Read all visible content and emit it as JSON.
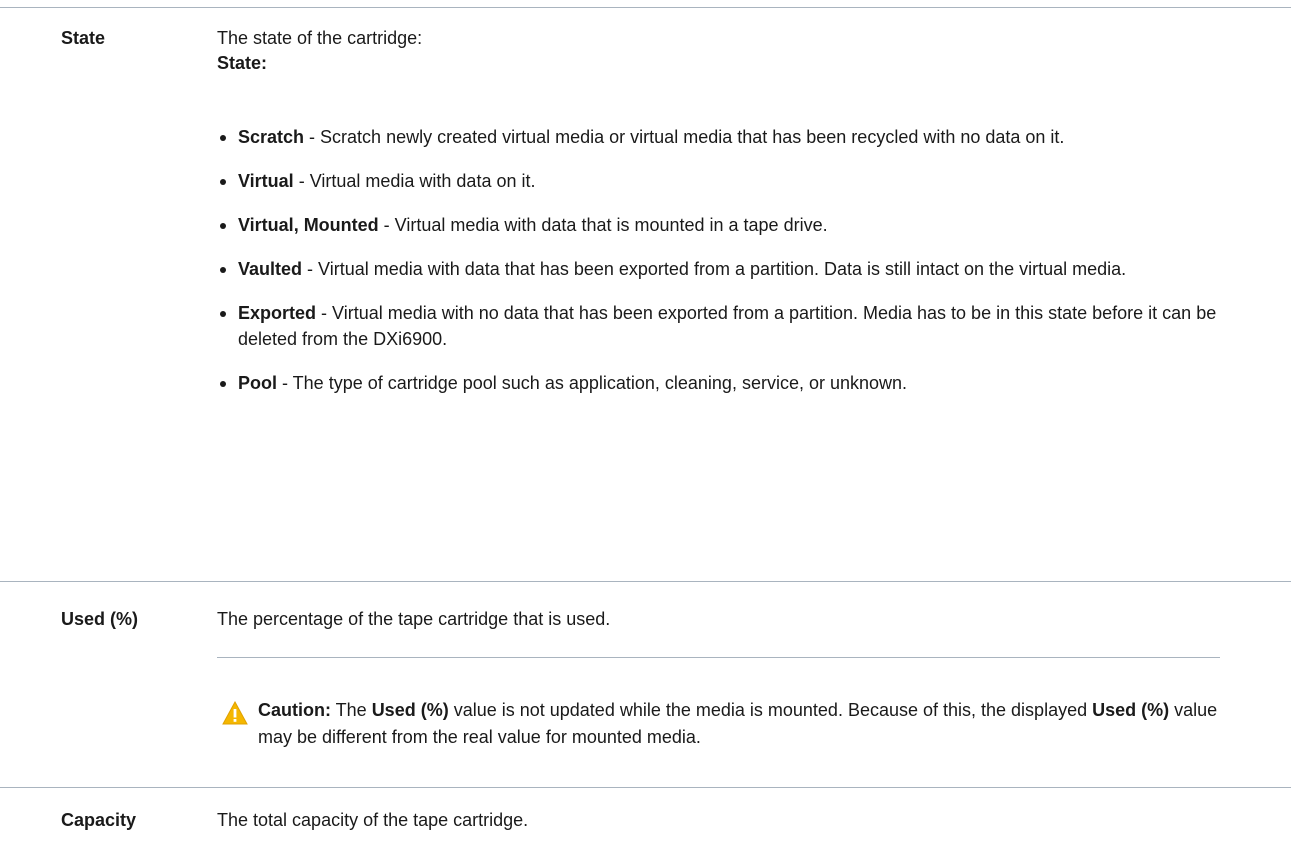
{
  "rows": {
    "state": {
      "term": "State",
      "desc": "The state of the cartridge:",
      "sub_heading": "State:",
      "items": [
        {
          "name": "Scratch",
          "sep": " - ",
          "text": "Scratch newly created virtual media or virtual media that has been recycled with no data on it."
        },
        {
          "name": "Virtual",
          "sep": " - ",
          "text": "Virtual media with data on it."
        },
        {
          "name": "Virtual, Mounted",
          "sep": " - ",
          "text": "Virtual media with data that is mounted in a tape drive."
        },
        {
          "name": "Vaulted",
          "sep": " - ",
          "text": "Virtual media with data that has been exported from a partition. Data is still intact on the virtual media."
        },
        {
          "name": "Exported",
          "sep": " - ",
          "text": "Virtual media with no data that has been exported from a partition. Media has to be in this state before it can be deleted from the DXi6900."
        },
        {
          "name": "Pool",
          "sep": " - ",
          "text": "The type of cartridge pool such as application, cleaning, service, or unknown."
        }
      ]
    },
    "used": {
      "term": "Used (%)",
      "desc": "The percentage of the tape cartridge that is used.",
      "caution": {
        "label": "Caution:",
        "t1": " The ",
        "b1": "Used (%)",
        "t2": " value is not updated while the media is mounted. Because of this, the displayed ",
        "b2": "Used (%)",
        "t3": " value may be different from the real value for mounted media.",
        "icon": "warning-triangle-icon",
        "icon_color": "#f5b700"
      }
    },
    "capacity": {
      "term": "Capacity",
      "desc": "The total capacity of the tape cartridge."
    }
  },
  "colors": {
    "rule": "#a9b4bf",
    "text": "#1a1a1a"
  }
}
